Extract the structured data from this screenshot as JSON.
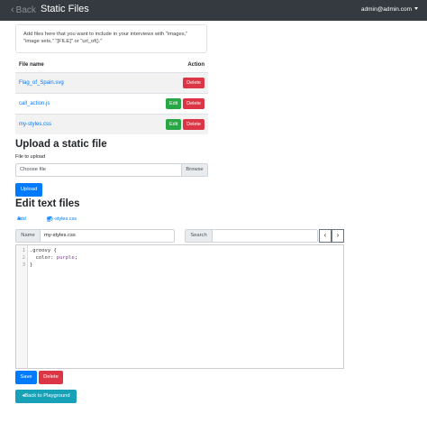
{
  "navbar": {
    "back_label": "Back",
    "title": "Static Files",
    "user": "admin@admin.com"
  },
  "info": {
    "text": "Add files here that you want to include in your interviews with \"images,\" \"image sets,\" \"[FILE]\" or \"url_of().\""
  },
  "files_table": {
    "headers": {
      "name": "File name",
      "action": "Action"
    },
    "rows": [
      {
        "name": "Flag_of_Spain.svg",
        "edit": "",
        "delete": "Delete"
      },
      {
        "name": "call_action.js",
        "edit": "Edit",
        "delete": "Delete"
      },
      {
        "name": "my-styles.css",
        "edit": "Edit",
        "delete": "Delete"
      }
    ]
  },
  "upload": {
    "heading": "Upload a static file",
    "file_label": "File to upload",
    "placeholder": "Choose file",
    "browse": "Browse",
    "button": "Upload"
  },
  "edit": {
    "heading": "Edit text files",
    "add_label": "Add",
    "file_dropdown": "my-styles.css",
    "name_label": "Name",
    "name_value": "my-styles.css",
    "search_label": "Search",
    "prev": "‹",
    "next": "›",
    "code_lines": [
      {
        "num": "1",
        "text": ".groovy {"
      },
      {
        "num": "2",
        "prop": "  color:",
        "value": " purple",
        "end": ";"
      },
      {
        "num": "3",
        "text": "}"
      }
    ]
  },
  "actions": {
    "save": "Save",
    "delete": "Delete",
    "back_to_playground": "Back to Playground"
  },
  "colors": {
    "navbar": "#343a40",
    "primary": "#007bff",
    "danger": "#dc3545",
    "success": "#28a745",
    "info": "#17a2b8"
  }
}
